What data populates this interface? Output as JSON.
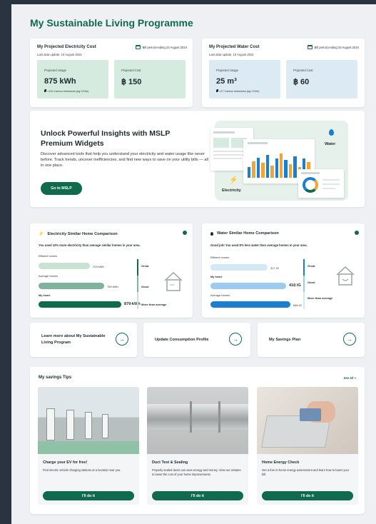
{
  "page": {
    "title": "My Sustainable Living Programme"
  },
  "electricity_cost": {
    "title": "My Projected Electricity Cost",
    "last_update": "Last data update: 10 August 2024",
    "bill_period": "Bill period ending 23 August 2024",
    "usage_label": "Projected Usage",
    "usage_value": "875 kWh",
    "emissions": "=110 Carbon emissions (kg CO2e)",
    "cost_label": "Projected Cost",
    "cost_value": "฿ 150"
  },
  "water_cost": {
    "title": "My Projected Water Cost",
    "last_update": "Last data update: 10 August 2024",
    "bill_period": "Bill period ending 23 August 2024",
    "usage_label": "Projected Usage",
    "usage_value": "25 m³",
    "emissions": "=27 Carbon emissions (kg CO2e)",
    "cost_label": "Projected Cost",
    "cost_value": "฿ 60"
  },
  "promo": {
    "title": "Unlock Powerful Insights with MSLP Premium Widgets",
    "description": "Discover advanced tools that help you understand your electricity and water usage like never before. Track trends, uncover inefficiencies, and find new ways to save on your utility bills — all in one place.",
    "button": "Go to MSLP",
    "water_label": "Water",
    "electricity_label": "Electricity"
  },
  "electricity_comparison": {
    "title": "Electricity Similar Home Comparison",
    "message": "You used 12% more electricity than average similar homes in your area.",
    "efficient_label": "Efficient homes",
    "efficient_value": "703 kWh",
    "efficient_fraction": 0.36,
    "average_label": "Average Homes",
    "average_value": "750 kWh",
    "average_fraction": 0.46,
    "my_label": "My home",
    "my_value": "870 kWh",
    "my_fraction": 0.58,
    "rating_great": "Great",
    "rating_good": "Good",
    "rating_more": "More than average",
    "house_text": "####"
  },
  "water_comparison": {
    "title": "Water Similar Home Comparison",
    "message": "Good job! You used 8% less water than average homes in your area.",
    "efficient_label": "Efficient homes",
    "efficient_value": "317 IG",
    "efficient_fraction": 0.4,
    "my_label": "My home",
    "my_value": "410 IG",
    "my_fraction": 0.53,
    "average_label": "Average Homes",
    "average_value": "666 IG",
    "average_fraction": 0.56,
    "rating_great": "Great",
    "rating_good": "Good",
    "rating_more": "More than average"
  },
  "links": [
    {
      "label": "Learn more about My Sustainable Living Program"
    },
    {
      "label": "Update Consumption Profile"
    },
    {
      "label": "My Savings Plan"
    }
  ],
  "tips": {
    "title": "My savings Tips",
    "see_all": "See All >",
    "items": [
      {
        "title": "Charge your EV for free!",
        "description": "Find electric vehicle charging stations at a location near you.",
        "button": "I'll do it"
      },
      {
        "title": "Duct Test & Sealing",
        "description": "Properly sealed ducts can save energy and money. View our rebates to lower the cost of your home improvements.",
        "button": "I'll do it"
      },
      {
        "title": "Home Energy Check",
        "description": "Get a free in-home energy assessment and learn how to lower your bill.",
        "button": "I'll do it"
      }
    ]
  },
  "colors": {
    "brand_green": "#0f6b4c",
    "light_green": "#d6ebe0",
    "light_blue": "#dbeaf3",
    "water_blue": "#1b7fd1"
  }
}
